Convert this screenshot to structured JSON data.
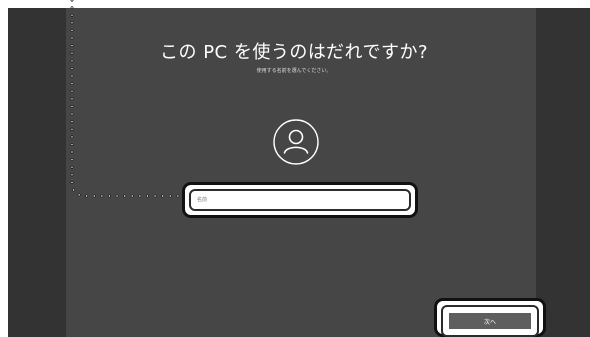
{
  "setup": {
    "title": "この PC を使うのはだれですか?",
    "subtitle": "使用する名前を選んでください。",
    "name_placeholder": "名前",
    "next_label": "次へ"
  },
  "icons": {
    "avatar": "user-avatar-icon"
  },
  "colors": {
    "background": "#3a3a3a",
    "panel": "#464646",
    "button": "#5e5e5e",
    "text": "#ffffff"
  }
}
